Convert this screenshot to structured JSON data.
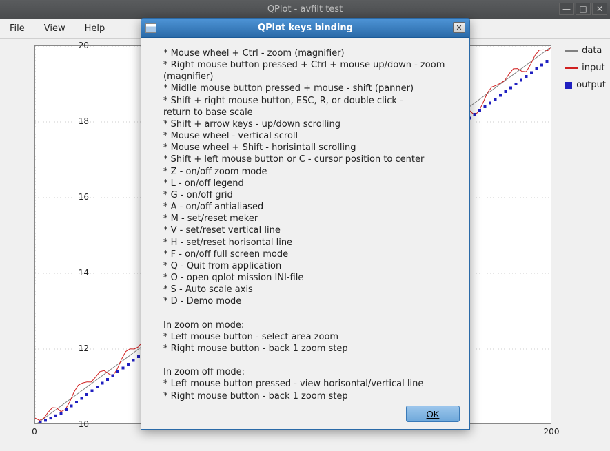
{
  "window": {
    "title": "QPlot - avfilt test"
  },
  "menu": {
    "file": "File",
    "view": "View",
    "help": "Help"
  },
  "legend": {
    "data": "data",
    "input": "input",
    "output": "output"
  },
  "chart_data": {
    "type": "line",
    "xlim": [
      0,
      200
    ],
    "ylim": [
      10,
      20
    ],
    "xticks": [
      0,
      200
    ],
    "yticks": [
      10,
      12,
      14,
      16,
      18,
      20
    ],
    "series": [
      {
        "name": "data",
        "color": "#808080",
        "style": "line",
        "x": [
          0,
          10,
          20,
          30,
          40,
          50,
          60,
          70,
          80,
          90,
          100,
          110,
          120,
          130,
          140,
          150,
          160,
          170,
          180,
          190,
          200
        ],
        "y": [
          10.0,
          10.5,
          11.0,
          11.5,
          12.0,
          12.5,
          13.0,
          13.5,
          14.0,
          14.5,
          15.0,
          15.5,
          16.0,
          16.5,
          17.0,
          17.5,
          18.0,
          18.5,
          19.0,
          19.5,
          20.0
        ]
      },
      {
        "name": "input",
        "color": "#d02020",
        "style": "noisy-line",
        "x": [
          0,
          10,
          20,
          30,
          40,
          50,
          60,
          70,
          80,
          90,
          100,
          110,
          120,
          130,
          140,
          150,
          160,
          170,
          180,
          190,
          200
        ],
        "y": [
          10.1,
          10.4,
          11.3,
          11.4,
          12.1,
          12.6,
          12.8,
          13.7,
          14.1,
          14.4,
          15.2,
          15.3,
          16.2,
          16.7,
          16.9,
          17.6,
          18.1,
          18.3,
          19.2,
          19.4,
          20.0
        ]
      },
      {
        "name": "output",
        "color": "#2020c0",
        "style": "dots",
        "x": [
          0,
          10,
          20,
          30,
          40,
          50,
          60,
          70,
          80,
          90,
          100,
          110,
          120,
          130,
          140,
          150,
          160,
          170,
          180,
          190,
          200
        ],
        "y": [
          10.0,
          10.3,
          10.8,
          11.3,
          11.8,
          12.3,
          12.8,
          13.2,
          13.7,
          14.2,
          14.7,
          15.2,
          15.7,
          16.2,
          16.7,
          17.2,
          17.7,
          18.2,
          18.7,
          19.2,
          19.7
        ]
      }
    ]
  },
  "dialog": {
    "title": "QPlot keys binding",
    "lines": [
      "* Mouse wheel + Ctrl - zoom (magnifier)",
      "* Right mouse button pressed + Ctrl + mouse up/down - zoom (magnifier)",
      "* Midlle mouse button pressed + mouse - shift (panner)",
      "* Shift + right mouse button, ESC, R,  or double click -",
      "   return to base scale",
      "* Shift + arrow keys - up/down scrolling",
      "* Mouse wheel - vertical scroll",
      "* Mouse wheel + Shift - horisintall scrolling",
      "* Shift + left mouse button or C - cursor position to center",
      "* Z - on/off zoom mode",
      "* L - on/off legend",
      "* G - on/off grid",
      "* A - on/off antialiased",
      "* M - set/reset meker",
      "* V - set/reset vertical line",
      "* H - set/reset horisontal line",
      "* F - on/off full screen mode",
      "* Q - Quit from application",
      "* O - open qplot mission INI-file",
      "* S - Auto scale axis",
      "* D - Demo mode",
      "",
      "In zoom on mode:",
      " * Left mouse button - select area zoom",
      " * Right mouse button - back 1 zoom step",
      "",
      "In zoom off mode:",
      " * Left mouse button pressed - view horisontal/vertical line",
      " * Right mouse button - back 1 zoom step"
    ],
    "ok": "OK"
  }
}
